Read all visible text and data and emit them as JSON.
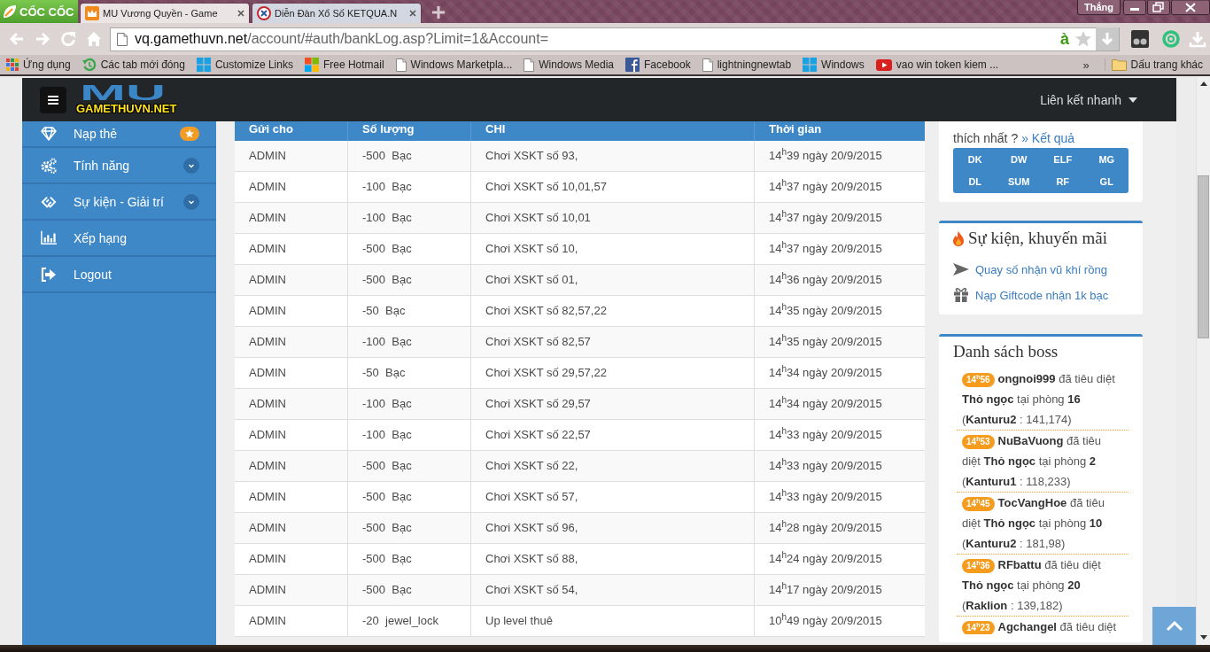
{
  "browser": {
    "menu_label": "CỐC CỐC",
    "tabs": [
      {
        "title": "MU Vương Quyền - Game",
        "selected": true
      },
      {
        "title": "Diễn Đàn Xổ Số KETQUA.N",
        "selected": false
      }
    ],
    "profile": "Thắng",
    "address": {
      "host": "vq.gamethuvn.net",
      "path": "/account/#auth/bankLog.asp?Limit=1&Account=",
      "input_method": "à"
    },
    "bookmarks": [
      {
        "label": "Ứng dụng",
        "kind": "apps"
      },
      {
        "label": "Các tab mới đóng",
        "kind": "history"
      },
      {
        "label": "Customize Links",
        "kind": "windows"
      },
      {
        "label": "Free Hotmail",
        "kind": "microsoft"
      },
      {
        "label": "Windows Marketpla...",
        "kind": "page"
      },
      {
        "label": "Windows Media",
        "kind": "page"
      },
      {
        "label": "Facebook",
        "kind": "facebook"
      },
      {
        "label": "lightningnewtab",
        "kind": "page"
      },
      {
        "label": "Windows",
        "kind": "windows"
      },
      {
        "label": "vao win token kiem ...",
        "kind": "youtube"
      }
    ],
    "more_bookmarks": "»",
    "other_bookmarks": "Dấu trang khác"
  },
  "header": {
    "logo_mark": "MU",
    "logo_text": "GAMETHUVN.NET",
    "quick_links": "Liên kết nhanh"
  },
  "sidebar": {
    "items": [
      {
        "label": "Nạp thẻ",
        "kind": "starred"
      },
      {
        "label": "Tính năng",
        "kind": "submenu"
      },
      {
        "label": "Sự kiện - Giải trí",
        "kind": "submenu"
      },
      {
        "label": "Xếp hạng",
        "kind": "plain"
      },
      {
        "label": "Logout",
        "kind": "plain"
      }
    ]
  },
  "table": {
    "columns": [
      "Gửi cho",
      "Số lượng",
      "CHI",
      "Thời gian"
    ],
    "rows": [
      [
        "ADMIN",
        "-500  Bạc",
        "Chơi XSKT số 93,",
        "14$^{h}$39 ngày 20/9/2015"
      ],
      [
        "ADMIN",
        "-100  Bạc",
        "Chơi XSKT số 10,01,57",
        "14$^{h}$37 ngày 20/9/2015"
      ],
      [
        "ADMIN",
        "-100  Bạc",
        "Chơi XSKT số 10,01",
        "14$^{h}$37 ngày 20/9/2015"
      ],
      [
        "ADMIN",
        "-500  Bạc",
        "Chơi XSKT số 10,",
        "14$^{h}$37 ngày 20/9/2015"
      ],
      [
        "ADMIN",
        "-500  Bạc",
        "Chơi XSKT số 01,",
        "14$^{h}$36 ngày 20/9/2015"
      ],
      [
        "ADMIN",
        "-50  Bạc",
        "Chơi XSKT số 82,57,22",
        "14$^{h}$35 ngày 20/9/2015"
      ],
      [
        "ADMIN",
        "-100  Bạc",
        "Chơi XSKT số 82,57",
        "14$^{h}$35 ngày 20/9/2015"
      ],
      [
        "ADMIN",
        "-50  Bạc",
        "Chơi XSKT số 29,57,22",
        "14$^{h}$34 ngày 20/9/2015"
      ],
      [
        "ADMIN",
        "-100  Bạc",
        "Chơi XSKT số 29,57",
        "14$^{h}$34 ngày 20/9/2015"
      ],
      [
        "ADMIN",
        "-100  Bạc",
        "Chơi XSKT số 22,57",
        "14$^{h}$33 ngày 20/9/2015"
      ],
      [
        "ADMIN",
        "-500  Bạc",
        "Chơi XSKT số 22,",
        "14$^{h}$33 ngày 20/9/2015"
      ],
      [
        "ADMIN",
        "-500  Bạc",
        "Chơi XSKT số 57,",
        "14$^{h}$33 ngày 20/9/2015"
      ],
      [
        "ADMIN",
        "-500  Bạc",
        "Chơi XSKT số 96,",
        "14$^{h}$28 ngày 20/9/2015"
      ],
      [
        "ADMIN",
        "-500  Bạc",
        "Chơi XSKT số 88,",
        "14$^{h}$24 ngày 20/9/2015"
      ],
      [
        "ADMIN",
        "-500  Bạc",
        "Chơi XSKT số 54,",
        "14$^{h}$17 ngày 20/9/2015"
      ],
      [
        "ADMIN",
        "-20  jewel_lock",
        "Up level thuê",
        "10$^{h}$49 ngày 20/9/2015"
      ]
    ]
  },
  "class_panel": {
    "prompt": "thích nhất ?",
    "link": "» Kết quả",
    "classes": [
      "DK",
      "DW",
      "ELF",
      "MG",
      "DL",
      "SUM",
      "RF",
      "GL"
    ]
  },
  "events": {
    "title": "Sự kiện, khuyến mãi",
    "links": [
      "Quay số nhận vũ khí rồng",
      "Nạp Giftcode nhận 1k bạc"
    ]
  },
  "bosses": {
    "title": "Danh sách boss",
    "entries": [
      {
        "time": "14$^{h}$56",
        "text": "**ongnoi999** đã tiêu diệt **Thỏ ngọc** tại phòng **16** (**Kanturu2** : 141,174)"
      },
      {
        "time": "14$^{h}$53",
        "text": "**NuBaVuong** đã tiêu diệt **Thỏ ngọc** tại phòng **2** (**Kanturu1** : 118,233)"
      },
      {
        "time": "14$^{h}$45",
        "text": "**TocVangHoe** đã tiêu diệt **Thỏ ngọc** tại phòng **10** (**Kanturu2** : 181,98)"
      },
      {
        "time": "14$^{h}$36",
        "text": "**RFbattu** đã tiêu diệt **Thỏ ngọc** tại phòng **20** (**Raklion** : 139,182)"
      },
      {
        "time": "14$^{h}$23",
        "text": "**Agchangel** đã tiêu diệt"
      }
    ]
  }
}
